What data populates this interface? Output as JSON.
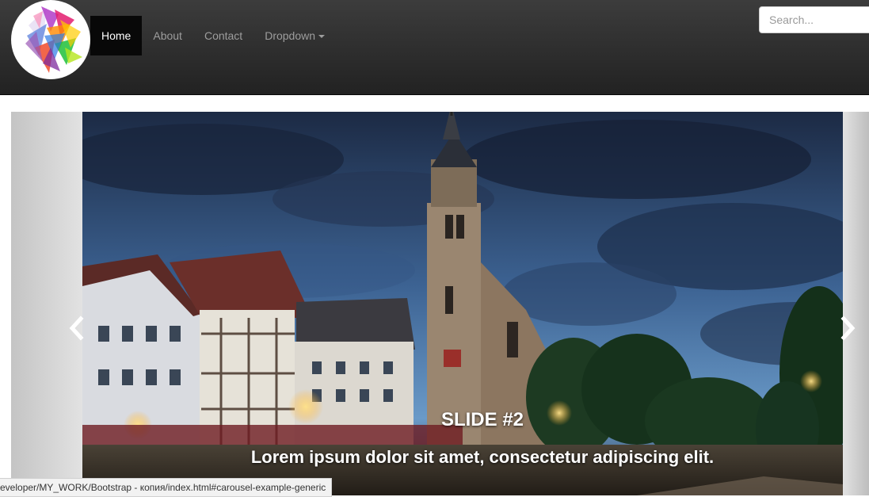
{
  "navbar": {
    "logo_icon": "colorful-triangles-logo-icon",
    "items": [
      {
        "label": "Home",
        "active": true
      },
      {
        "label": "About",
        "active": false
      },
      {
        "label": "Contact",
        "active": false
      },
      {
        "label": "Dropdown",
        "active": false
      }
    ],
    "search": {
      "placeholder": "Search...",
      "value": ""
    }
  },
  "carousel": {
    "prev_icon": "chevron-left-icon",
    "next_icon": "chevron-right-icon",
    "slide": {
      "title": "SLIDE #2",
      "text": "Lorem ipsum dolor sit amet, consectetur adipiscing elit."
    }
  },
  "statusbar": {
    "url": "eveloper/MY_WORK/Bootstrap - копия/index.html#carousel-example-generic"
  },
  "colors": {
    "navbar_bg": "#222222",
    "active_item_bg": "#080808",
    "nav_text": "#9d9d9d",
    "active_text": "#ffffff"
  }
}
